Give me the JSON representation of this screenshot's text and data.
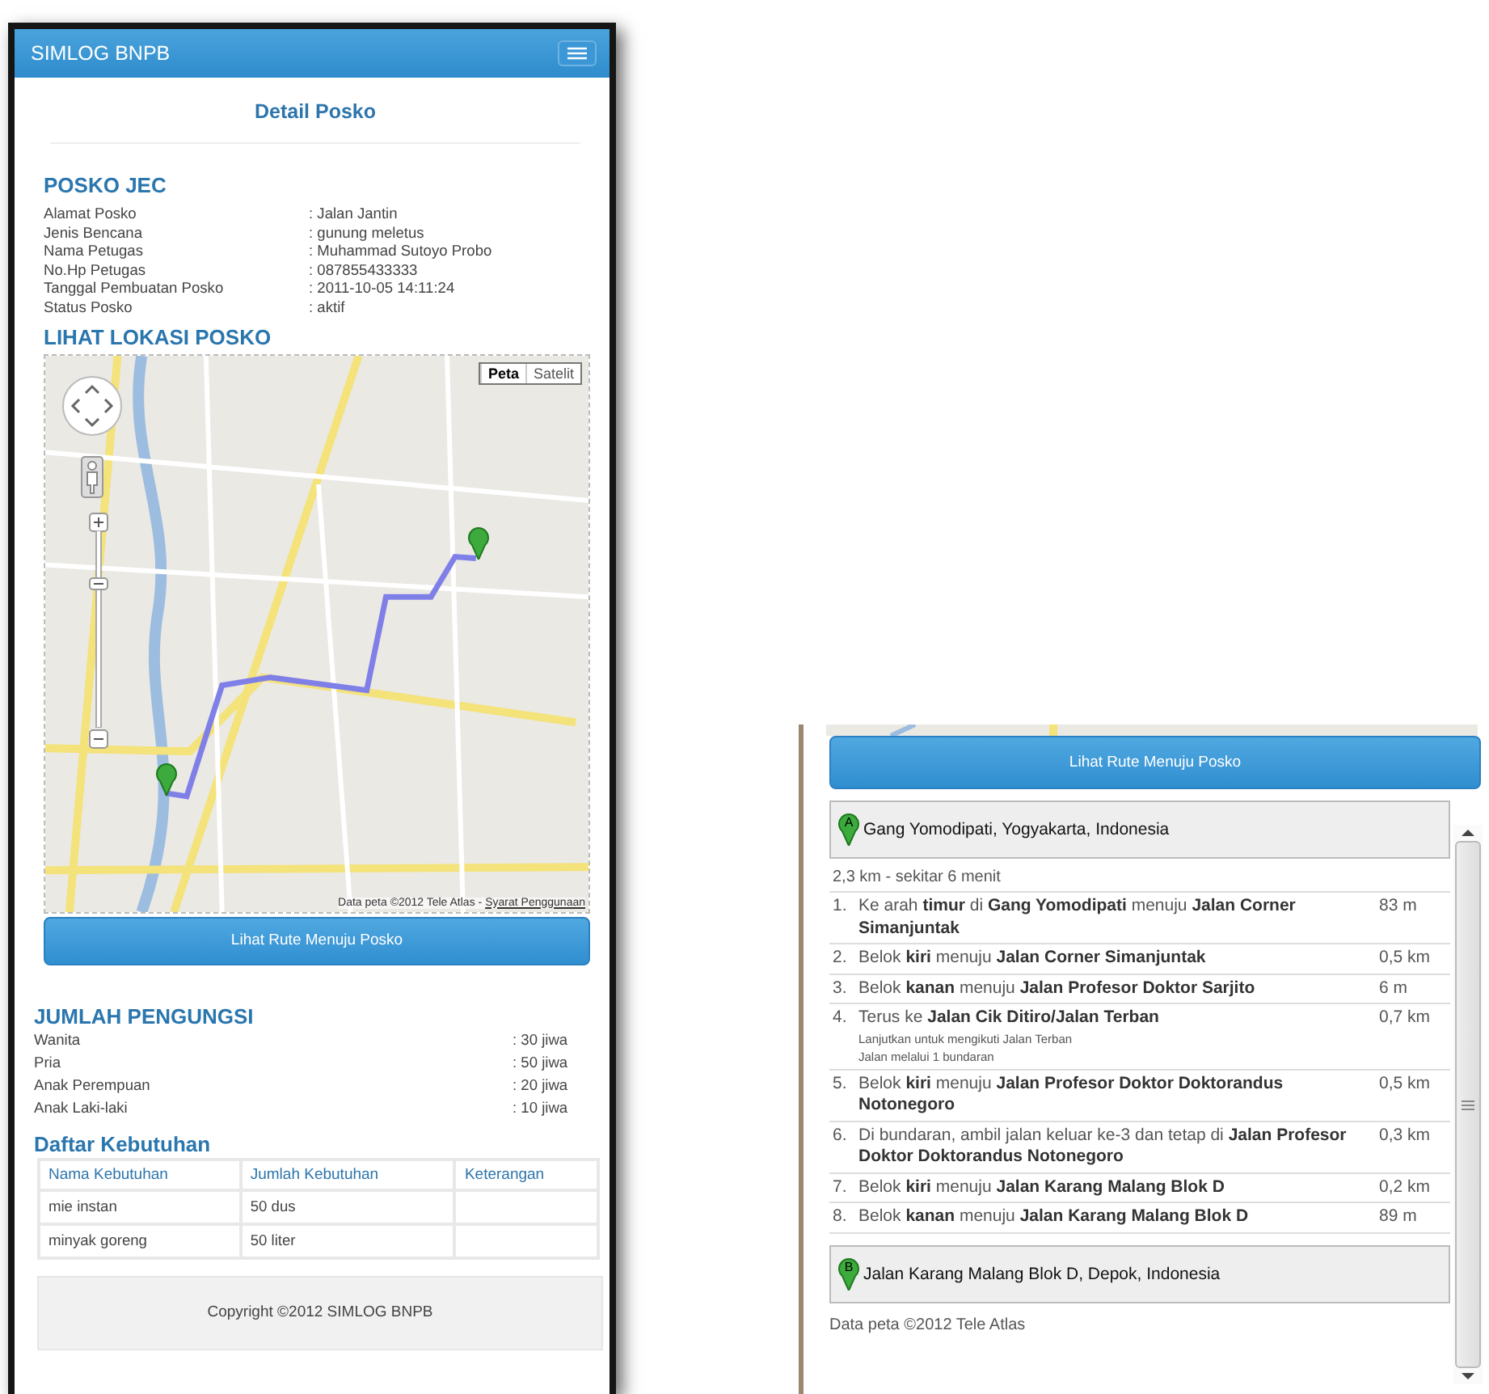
{
  "app_bar": {
    "title": "SIMLOG BNPB"
  },
  "page_title": "Detail Posko",
  "posko": {
    "heading": "POSKO JEC",
    "fields": [
      {
        "label": "Alamat Posko",
        "value": ": Jalan Jantin"
      },
      {
        "label": "Jenis Bencana",
        "value": ": gunung meletus"
      },
      {
        "label": "Nama Petugas",
        "value": ": Muhammad Sutoyo Probo"
      },
      {
        "label": "No.Hp Petugas",
        "value": ": 087855433333"
      },
      {
        "label": "Tanggal Pembuatan Posko",
        "value": ": 2011-10-05 14:11:24"
      },
      {
        "label": "Status Posko",
        "value": ": aktif"
      }
    ]
  },
  "map_section": {
    "heading": "LIHAT LOKASI POSKO",
    "map_types": [
      {
        "label": "Peta",
        "selected": true
      },
      {
        "label": "Satelit",
        "selected": false
      }
    ],
    "attribution": "Data peta ©2012 Tele Atlas -",
    "terms_link": "Syarat Penggunaan",
    "route_button": "Lihat Rute Menuju Posko"
  },
  "refugees": {
    "heading": "JUMLAH PENGUNGSI",
    "rows": [
      {
        "label": "Wanita",
        "value": ": 30 jiwa"
      },
      {
        "label": "Pria",
        "value": ": 50 jiwa"
      },
      {
        "label": "Anak Perempuan",
        "value": ": 20 jiwa"
      },
      {
        "label": "Anak Laki-laki",
        "value": ": 10 jiwa"
      }
    ]
  },
  "needs": {
    "heading": "Daftar Kebutuhan",
    "columns": [
      "Nama Kebutuhan",
      "Jumlah Kebutuhan",
      "Keterangan"
    ],
    "rows": [
      {
        "name": "mie instan",
        "amount": "50 dus"
      },
      {
        "name": "minyak goreng",
        "amount": "50 liter"
      }
    ]
  },
  "footer": "Copyright ©2012 SIMLOG BNPB",
  "directions_panel": {
    "route_button": "Lihat Rute Menuju Posko",
    "start": {
      "marker": "A",
      "address": "Gang Yomodipati, Yogyakarta, Indonesia"
    },
    "summary": "2,3 km - sekitar 6 menit",
    "steps": [
      {
        "number": "1.",
        "text": "Ke arah **timur** di **Gang Yomodipati** menuju **Jalan Corner Simanjuntak**",
        "distance": "83 m"
      },
      {
        "number": "2.",
        "text": "Belok **kiri** menuju **Jalan Corner Simanjuntak**",
        "distance": "0,5 km"
      },
      {
        "number": "3.",
        "text": "Belok **kanan** menuju **Jalan Profesor Doktor Sarjito**",
        "distance": "6 m"
      },
      {
        "number": "4.",
        "text": "Terus ke **Jalan Cik Ditiro/Jalan Terban**",
        "distance": "0,7 km",
        "notes": [
          "Lanjutkan untuk mengikuti Jalan Terban",
          "Jalan melalui 1 bundaran"
        ]
      },
      {
        "number": "5.",
        "text": "Belok **kiri** menuju **Jalan Profesor Doktor Doktorandus Notonegoro**",
        "distance": "0,5 km"
      },
      {
        "number": "6.",
        "text": "Di bundaran, ambil jalan keluar ke-3 dan tetap di **Jalan Profesor Doktor Doktorandus Notonegoro**",
        "distance": "0,3 km"
      },
      {
        "number": "7.",
        "text": "Belok **kiri** menuju **Jalan Karang Malang Blok D**",
        "distance": "0,2 km"
      },
      {
        "number": "8.",
        "text": "Belok **kanan** menuju **Jalan Karang Malang Blok D**",
        "distance": "89 m"
      }
    ],
    "end": {
      "marker": "B",
      "address": "Jalan Karang Malang Blok D, Depok, Indonesia"
    },
    "attribution": "Data peta ©2012 Tele Atlas"
  }
}
